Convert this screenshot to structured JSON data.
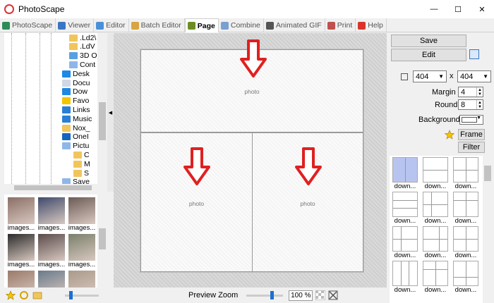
{
  "window": {
    "title": "PhotoScape",
    "minimize": "—",
    "maximize": "☐",
    "close": "✕"
  },
  "tabs": [
    {
      "label": "PhotoScape",
      "color": "#2e8b57",
      "active": false
    },
    {
      "label": "Viewer",
      "color": "#3a75c4",
      "active": false
    },
    {
      "label": "Editor",
      "color": "#4a90d9",
      "active": false
    },
    {
      "label": "Batch Editor",
      "color": "#d9a441",
      "active": false
    },
    {
      "label": "Page",
      "color": "#6b8e23",
      "active": true
    },
    {
      "label": "Combine",
      "color": "#7a9fd1",
      "active": false
    },
    {
      "label": "Animated GIF",
      "color": "#555555",
      "active": false
    },
    {
      "label": "Print",
      "color": "#c0504d",
      "active": false
    },
    {
      "label": "Help",
      "color": "#d9342b",
      "active": false
    }
  ],
  "tree": {
    "items": [
      {
        "label": ".Ld2\\",
        "icon": "folder-icon",
        "color": "#f2c55c"
      },
      {
        "label": ".LdV",
        "icon": "folder-icon",
        "color": "#f2c55c"
      },
      {
        "label": "3D O",
        "icon": "cube-icon",
        "color": "#5aa0e0"
      },
      {
        "label": "Cont",
        "icon": "contacts-icon",
        "color": "#8fb6e8"
      },
      {
        "label": "Desk",
        "icon": "desktop-icon",
        "color": "#1e88e5"
      },
      {
        "label": "Docu",
        "icon": "document-icon",
        "color": "#cfd8e6"
      },
      {
        "label": "Dow",
        "icon": "download-icon",
        "color": "#1e88e5"
      },
      {
        "label": "Favo",
        "icon": "star-icon",
        "color": "#f5c400"
      },
      {
        "label": "Links",
        "icon": "link-arrow-icon",
        "color": "#2a7fd4"
      },
      {
        "label": "Music",
        "icon": "music-icon",
        "color": "#2a7fd4"
      },
      {
        "label": "Nox_",
        "icon": "folder-icon",
        "color": "#f2c55c"
      },
      {
        "label": "OneI",
        "icon": "cloud-icon",
        "color": "#1565c0"
      },
      {
        "label": "Pictu",
        "icon": "pictures-icon",
        "color": "#8fb6e8"
      },
      {
        "label": "C",
        "icon": "folder-icon",
        "color": "#f2c55c"
      },
      {
        "label": "M",
        "icon": "folder-icon",
        "color": "#f2c55c"
      },
      {
        "label": "S",
        "icon": "folder-icon",
        "color": "#f2c55c"
      },
      {
        "label": "Save",
        "icon": "save-icon",
        "color": "#8fb6e8"
      }
    ]
  },
  "thumbnails": [
    {
      "caption": "images...",
      "color": "#8a6f66"
    },
    {
      "caption": "images...",
      "color": "#3f4a6b"
    },
    {
      "caption": "images...",
      "color": "#6b5a55"
    },
    {
      "caption": "images...",
      "color": "#2b2b2b"
    },
    {
      "caption": "images...",
      "color": "#5a4a4a"
    },
    {
      "caption": "images...",
      "color": "#7a7f6a"
    },
    {
      "caption": "",
      "color": "#9a7a6a"
    },
    {
      "caption": "",
      "color": "#6a7a8a"
    },
    {
      "caption": "",
      "color": "#aa9a8a"
    }
  ],
  "canvas": {
    "cells": [
      {
        "label": "photo"
      },
      {
        "label": "photo"
      },
      {
        "label": "photo"
      }
    ],
    "arrow_color": "#e02020"
  },
  "zoom": {
    "label": "Preview Zoom",
    "value": "100 %"
  },
  "right": {
    "save": "Save",
    "edit": "Edit",
    "width": "404",
    "height": "404",
    "x_label": "x",
    "margin_label": "Margin",
    "margin": "4",
    "round_label": "Round",
    "round": "8",
    "background_label": "Background",
    "frame": "Frame",
    "filter": "Filter",
    "layouts": [
      "down...",
      "down...",
      "down...",
      "down...",
      "down...",
      "down...",
      "down...",
      "down...",
      "down...",
      "down...",
      "down...",
      "down..."
    ]
  }
}
